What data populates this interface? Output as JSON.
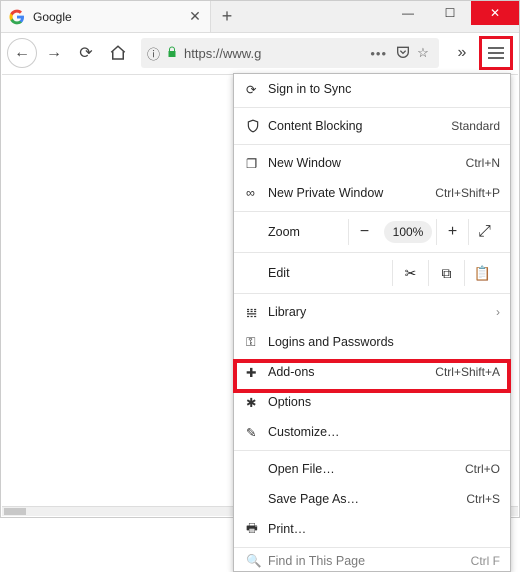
{
  "tab": {
    "title": "Google"
  },
  "addr": {
    "info_icon": "ⓘ",
    "url_display": "https://www.g",
    "ell": "•••"
  },
  "menu": {
    "sync": "Sign in to Sync",
    "content_blocking": {
      "label": "Content Blocking",
      "value": "Standard"
    },
    "new_window": {
      "label": "New Window",
      "shortcut": "Ctrl+N"
    },
    "new_private": {
      "label": "New Private Window",
      "shortcut": "Ctrl+Shift+P"
    },
    "zoom": {
      "label": "Zoom",
      "value": "100%"
    },
    "edit": {
      "label": "Edit"
    },
    "library": "Library",
    "logins": "Logins and Passwords",
    "addons": {
      "label": "Add-ons",
      "shortcut": "Ctrl+Shift+A"
    },
    "options": "Options",
    "customize": "Customize…",
    "open_file": {
      "label": "Open File…",
      "shortcut": "Ctrl+O"
    },
    "save_as": {
      "label": "Save Page As…",
      "shortcut": "Ctrl+S"
    },
    "print": "Print…",
    "find": {
      "label": "Find in This Page",
      "shortcut": "Ctrl F"
    }
  }
}
